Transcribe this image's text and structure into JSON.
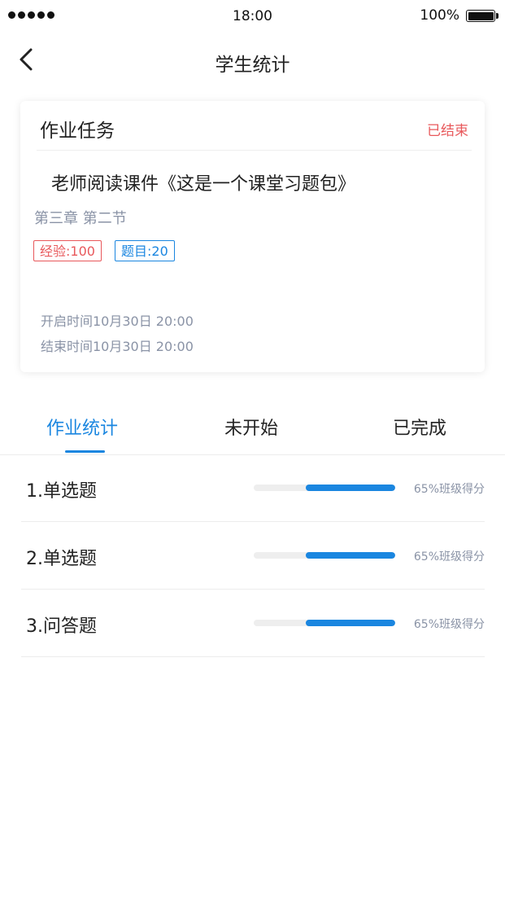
{
  "status_bar": {
    "time": "18:00",
    "battery": "100%"
  },
  "nav": {
    "title": "学生统计",
    "back_icon": "chevron-left-icon"
  },
  "task_card": {
    "header": "作业任务",
    "status": "已结束",
    "title": "老师阅读课件《这是一个课堂习题包》",
    "chapter": "第三章 第二节",
    "experience_badge": "经验:100",
    "questions_badge": "题目:20",
    "start_time": "开启时间10月30日 20:00",
    "end_time": "结束时间10月30日 20:00"
  },
  "tabs": [
    {
      "label": "作业统计",
      "active": true
    },
    {
      "label": "未开始",
      "active": false
    },
    {
      "label": "已完成",
      "active": false
    }
  ],
  "questions": [
    {
      "label": "1.单选题",
      "score_label": "65%班级得分",
      "progress": 0.63
    },
    {
      "label": "2.单选题",
      "score_label": "65%班级得分",
      "progress": 0.63
    },
    {
      "label": "3.问答题",
      "score_label": "65%班级得分",
      "progress": 0.63
    }
  ],
  "colors": {
    "accent": "#1a86e0",
    "danger": "#e8585b",
    "muted": "#8a93a6"
  }
}
